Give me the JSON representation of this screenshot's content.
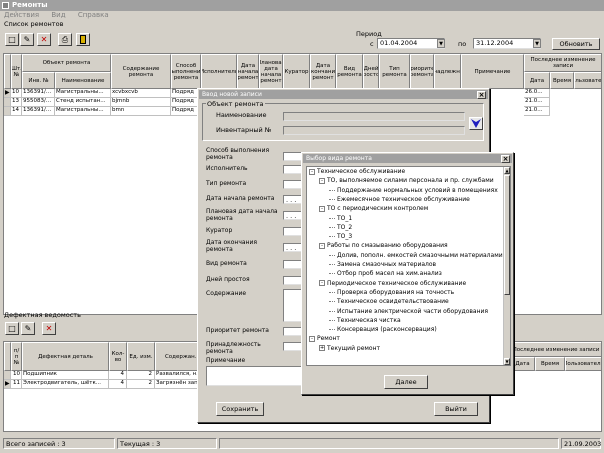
{
  "window": {
    "title": "Ремонты"
  },
  "menu": [
    "Действия",
    "Вид",
    "Справка"
  ],
  "top": {
    "list_label": "Список ремонтов",
    "period_label": "Период",
    "from_label": "с",
    "from_value": "01.04.2004",
    "to_label": "по",
    "to_value": "31.12.2004",
    "refresh_label": "Обновить"
  },
  "table1": {
    "headers": {
      "num": "Шт. №",
      "object": "Объект ремонта",
      "inv": "Инв. №",
      "name": "Наименование",
      "content": "Содержание ремонта",
      "method": "Способ выполнения ремонта",
      "executor": "Исполнитель",
      "start": "Дата начала ремонт",
      "plan": "Плановая дата начала ремонт",
      "curator": "Куратор",
      "end": "Дата окончания ремонт",
      "kind": "Вид ремонта",
      "days": "Дней простоя",
      "type": "Тип ремонта",
      "priority": "Приоритет ремонта",
      "belongs": "Принадлежность",
      "note": "Примечание",
      "last": "Последнее изменение записи",
      "date": "Дата",
      "time": "Время",
      "user": "Пользователь"
    },
    "rows": [
      {
        "n": "10",
        "inv": "136391/...",
        "name": "Магистральны...",
        "content": "xcvbxcvb",
        "method": "Подряд",
        "date": "26.0..."
      },
      {
        "n": "13",
        "inv": "955083/...",
        "name": "Стенд испытан...",
        "content": "bjmnb",
        "method": "Подряд",
        "date": "21.0..."
      },
      {
        "n": "14",
        "inv": "136391/...",
        "name": "Магистральны...",
        "content": "bmn",
        "method": "Подряд",
        "date": "21.0..."
      }
    ]
  },
  "defect": {
    "label": "Дефектная ведомость",
    "headers": {
      "num": "п/п №",
      "detail": "Дефектная деталь",
      "qty": "Кол-во",
      "unit": "Ед. изм.",
      "content": "Содержан...",
      "last": "Последнее изменение записи",
      "date": "Дата",
      "time": "Время",
      "user": "Пользователь"
    },
    "rows": [
      {
        "n": "10",
        "detail": "Подшипник",
        "qty": "4",
        "unit": "2",
        "content": "Развалился, н..."
      },
      {
        "n": "11",
        "detail": "Электродвигатель, шётк...",
        "qty": "4",
        "unit": "2",
        "content": "Загрязнён запч..."
      }
    ]
  },
  "status": {
    "total": "Всего записей : 3",
    "current": "Текущая : 3",
    "date": "21.09.2003"
  },
  "dialog1": {
    "title": "Ввод новой записи",
    "group_label": "Объект ремонта",
    "name_label": "Наименование",
    "inv_label": "Инвентарный №",
    "fields": [
      "Способ выполнения ремонта",
      "Исполнитель",
      "Тип ремонта",
      "Дата начала ремонта",
      "Плановая дата начала ремонта",
      "Куратор",
      "Дата окончания ремонта",
      "Вид ремонта",
      "Дней простоя",
      "Содержание",
      "Приоритет ремонта",
      "Принадлежность ремонта",
      "Примечание"
    ],
    "date_mask": ". . .",
    "save_label": "Сохранить",
    "exit_label": "Выйти"
  },
  "dialog2": {
    "title": "Выбор вида ремонта",
    "tree": [
      {
        "text": "Техническое обслуживание",
        "level": 0,
        "pm": "-"
      },
      {
        "text": "ТО, выполняемое силами персонала и пр. службами",
        "level": 1,
        "pm": "-"
      },
      {
        "text": "Поддержание нормальных условий в помещениях",
        "level": 2
      },
      {
        "text": "Ежемесячное техническое обслуживание",
        "level": 2
      },
      {
        "text": "ТО с периодическим контролем",
        "level": 1,
        "pm": "-"
      },
      {
        "text": "ТО_1",
        "level": 2
      },
      {
        "text": "ТО_2",
        "level": 2
      },
      {
        "text": "ТО_3",
        "level": 2
      },
      {
        "text": "Работы по смазыванию оборудования",
        "level": 1,
        "pm": "-"
      },
      {
        "text": "Долив, пополн. емкостей смазочными материалами",
        "level": 2
      },
      {
        "text": "Замена смазочных материалов",
        "level": 2
      },
      {
        "text": "Отбор проб масел на хим.анализ",
        "level": 2
      },
      {
        "text": "Периодическое техническое обслуживание",
        "level": 1,
        "pm": "-"
      },
      {
        "text": "Проверка оборудования на точность",
        "level": 2
      },
      {
        "text": "Техническое освидетельствование",
        "level": 2
      },
      {
        "text": "Испытание электрической части оборудования",
        "level": 2
      },
      {
        "text": "Техническая чистка",
        "level": 2
      },
      {
        "text": "Консервация (расконсервация)",
        "level": 2
      },
      {
        "text": "Ремонт",
        "level": 0,
        "pm": "-"
      },
      {
        "text": "Текущий ремонт",
        "level": 1,
        "pm": "+"
      }
    ],
    "next_label": "Далее"
  }
}
